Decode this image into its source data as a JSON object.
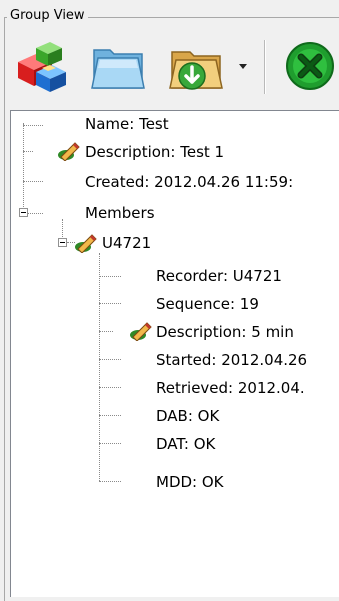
{
  "group_view": {
    "title": "Group View"
  },
  "toolbar": {
    "buttons": [
      {
        "name": "blocks-icon"
      },
      {
        "name": "folder-icon"
      },
      {
        "name": "download-folder-icon"
      },
      {
        "name": "close-icon"
      }
    ]
  },
  "tree": {
    "root": {
      "name_label": "Name: Test",
      "description_label": "Description: Test 1",
      "created_label": "Created: 2012.04.26 11:59:",
      "members_label": "Members"
    },
    "member": {
      "label": "U4721",
      "fields": [
        "Recorder: U4721",
        "Sequence: 19",
        "Description: 5 min",
        "Started: 2012.04.26",
        "Retrieved: 2012.04.",
        "DAB: OK",
        "DAT: OK",
        "MDD: OK"
      ]
    }
  },
  "colors": {
    "window_bg": "#f0f0f0",
    "tree_bg": "#ffffff",
    "close_green": "#1f9d2e",
    "folder_blue": "#86c3ea"
  }
}
